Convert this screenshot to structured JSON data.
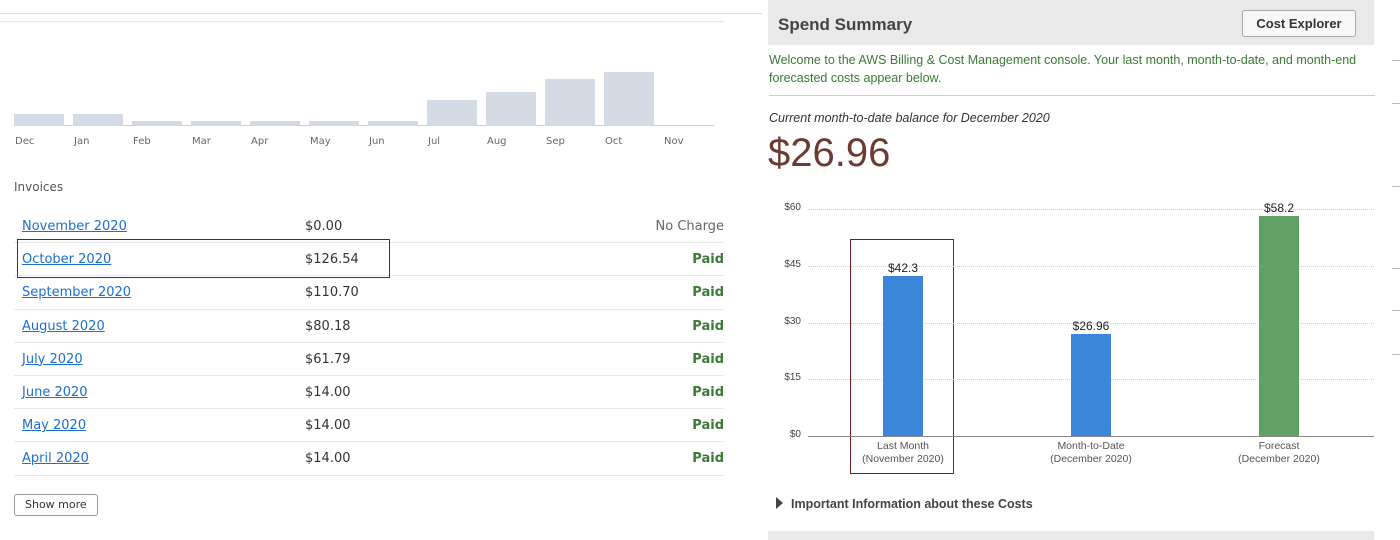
{
  "monthly_chart": {
    "bars": [
      {
        "label": "Dec",
        "level": 0.22
      },
      {
        "label": "Jan",
        "level": 0.22
      },
      {
        "label": "Feb",
        "level": 0.1
      },
      {
        "label": "Mar",
        "level": 0.1
      },
      {
        "label": "Apr",
        "level": 0.1
      },
      {
        "label": "May",
        "level": 0.1
      },
      {
        "label": "Jun",
        "level": 0.1
      },
      {
        "label": "Jul",
        "level": 0.49
      },
      {
        "label": "Aug",
        "level": 0.63
      },
      {
        "label": "Sep",
        "level": 0.87
      },
      {
        "label": "Oct",
        "level": 1.0
      },
      {
        "label": "Nov",
        "level": 0.0
      }
    ]
  },
  "invoices": {
    "heading": "Invoices",
    "rows": [
      {
        "month": "November 2020",
        "amount": "$0.00",
        "status": "No Charge",
        "paid": false
      },
      {
        "month": "October 2020",
        "amount": "$126.54",
        "status": "Paid",
        "paid": true
      },
      {
        "month": "September 2020",
        "amount": "$110.70",
        "status": "Paid",
        "paid": true
      },
      {
        "month": "August 2020",
        "amount": "$80.18",
        "status": "Paid",
        "paid": true
      },
      {
        "month": "July 2020",
        "amount": "$61.79",
        "status": "Paid",
        "paid": true
      },
      {
        "month": "June 2020",
        "amount": "$14.00",
        "status": "Paid",
        "paid": true
      },
      {
        "month": "May 2020",
        "amount": "$14.00",
        "status": "Paid",
        "paid": true
      },
      {
        "month": "April 2020",
        "amount": "$14.00",
        "status": "Paid",
        "paid": true
      }
    ],
    "show_more_label": "Show more"
  },
  "spend_summary": {
    "title": "Spend Summary",
    "cost_explorer_label": "Cost Explorer",
    "welcome": "Welcome to the AWS Billing & Cost Management console. Your last month, month-to-date, and month-end forecasted costs appear below.",
    "balance_label": "Current month-to-date balance for December 2020",
    "balance_value": "$26.96",
    "important_info_label": "Important Information about these Costs"
  },
  "colors": {
    "bar_blue": "#3b86d8",
    "bar_green": "#62a165",
    "paid_green": "#3b7a36",
    "link_blue": "#1a6fd0",
    "highlight_red": "#7a1d22"
  },
  "chart_data": {
    "type": "bar",
    "categories": [
      [
        "Last Month",
        "(November 2020)"
      ],
      [
        "Month-to-Date",
        "(December 2020)"
      ],
      [
        "Forecast",
        "(December 2020)"
      ]
    ],
    "values": [
      42.3,
      26.96,
      58.2
    ],
    "value_labels": [
      "$42.3",
      "$26.96",
      "$58.2"
    ],
    "colors": [
      "#3b86d8",
      "#3b86d8",
      "#62a165"
    ],
    "y_ticks": [
      "$0",
      "$15",
      "$30",
      "$45",
      "$60"
    ],
    "ylim": [
      0,
      60
    ],
    "grid": true
  }
}
